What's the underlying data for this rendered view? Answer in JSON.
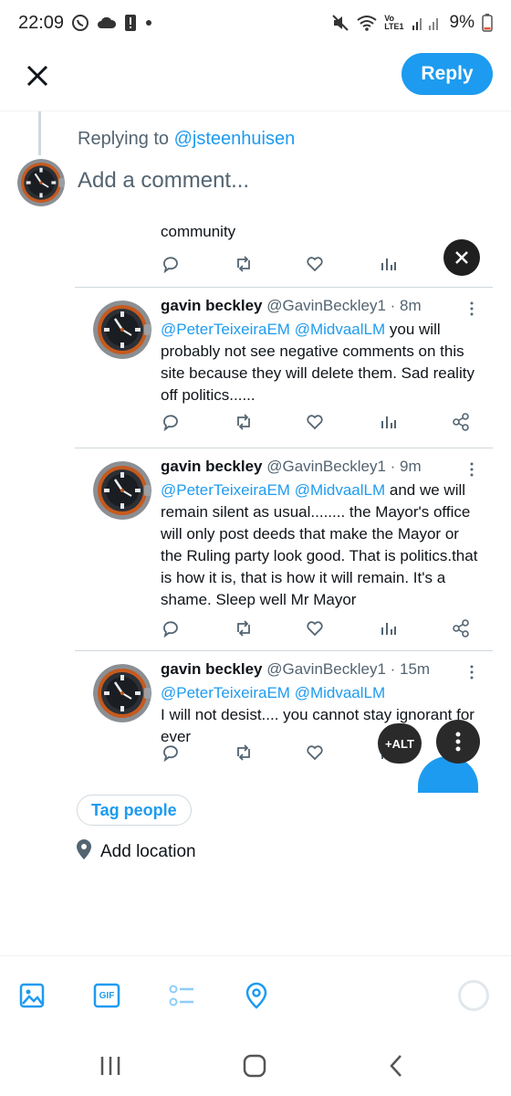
{
  "status_bar": {
    "time": "22:09",
    "battery": "9%",
    "network": "Vo\nLTE1",
    "icons": [
      "whatsapp-icon",
      "cloud-icon",
      "alert-icon",
      "dot-icon",
      "mute-icon",
      "wifi-icon",
      "signal-icon",
      "battery-icon"
    ]
  },
  "header": {
    "reply_label": "Reply"
  },
  "compose": {
    "replying_prefix": "Replying to ",
    "replying_handle": "@jsteenhuisen",
    "placeholder": "Add a comment..."
  },
  "attached_image": {
    "top_fragment": "community",
    "tweets": [
      {
        "name": "gavin beckley",
        "meta": "@GavinBeckley1 · 8m",
        "mentions": "@PeterTeixeiraEM @MidvaalLM",
        "text": " you will probably not see negative comments on this site because they will delete them. Sad reality off politics......"
      },
      {
        "name": "gavin beckley",
        "meta": "@GavinBeckley1 · 9m",
        "mentions": "@PeterTeixeiraEM @MidvaalLM",
        "text": " and we will remain silent as usual........ the Mayor's office will only post deeds that make the Mayor or the Ruling party look good. That is politics.that is how it is, that is how it will remain. It's a shame. Sleep well Mr Mayor"
      },
      {
        "name": "gavin beckley",
        "meta": "@GavinBeckley1 · 15m",
        "mentions": "@PeterTeixeiraEM @MidvaalLM",
        "text": "I will not desist.... you cannot stay ignorant for ever"
      }
    ],
    "alt_label": "+ALT"
  },
  "tag_people_label": "Tag people",
  "location_label": "Add location",
  "toolbar": {
    "gif_label": "GIF",
    "items": [
      "image-icon",
      "gif-icon",
      "poll-icon",
      "location-icon",
      "char-counter"
    ]
  },
  "colors": {
    "accent": "#1d9bf0",
    "text": "#0f1419",
    "muted": "#536471",
    "border": "#cfd9de"
  }
}
